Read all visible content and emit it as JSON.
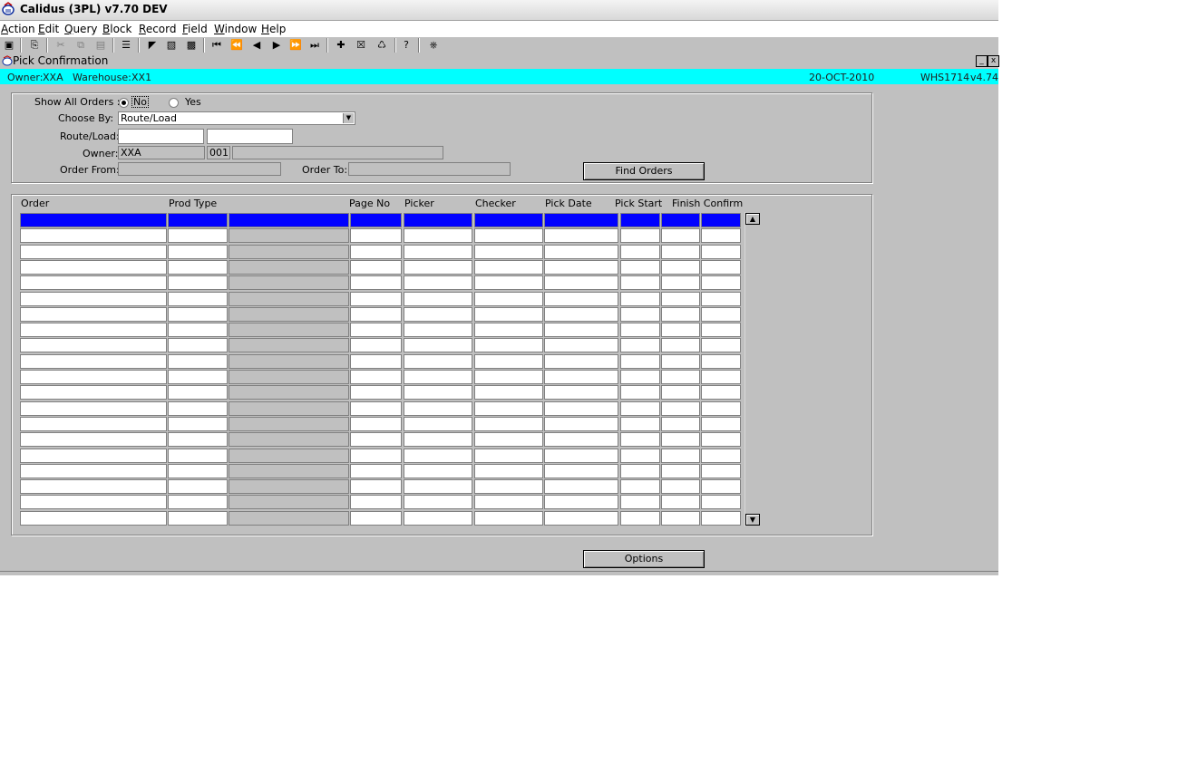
{
  "app": {
    "title": "Calidus (3PL) v7.70 DEV"
  },
  "menu": [
    "Action",
    "Edit",
    "Query",
    "Block",
    "Record",
    "Field",
    "Window",
    "Help"
  ],
  "toolbar": {
    "icons": [
      "save-icon",
      "print-icon",
      "cut-icon",
      "copy-icon",
      "paste-icon",
      "list-icon",
      "enter-query-icon",
      "execute-query-icon",
      "cancel-query-icon",
      "first-record-icon",
      "previous-block-icon",
      "previous-record-icon",
      "next-record-icon",
      "next-block-icon",
      "last-record-icon",
      "insert-record-icon",
      "delete-record-icon",
      "duplicate-icon",
      "help-icon",
      "exit-icon"
    ]
  },
  "window": {
    "title": "Pick Confirmation",
    "minimize": "_",
    "close": "x"
  },
  "info": {
    "owner_label": "Owner:",
    "owner": "XXA",
    "warehouse_label": "Warehouse:",
    "warehouse": "XX1",
    "date": "20-OCT-2010",
    "form": "WHS1714",
    "version": "v4.74"
  },
  "criteria": {
    "show_all_label": "Show All Orders :",
    "opt_no": "No",
    "opt_yes": "Yes",
    "selected": "No",
    "choose_by_label": "Choose By:",
    "choose_by_value": "Route/Load",
    "route_load_label": "Route/Load:",
    "owner_label": "Owner:",
    "owner_code": "XXA",
    "owner_seq": "001",
    "order_from_label": "Order From:",
    "order_to_label": "Order To:",
    "find_button": "Find Orders"
  },
  "grid": {
    "headers": [
      "Order",
      "Prod Type",
      "Page No",
      "Picker",
      "Checker",
      "Pick Date",
      "Pick Start",
      "Finish Confirm"
    ],
    "row_count": 20
  },
  "footer": {
    "options_button": "Options"
  }
}
